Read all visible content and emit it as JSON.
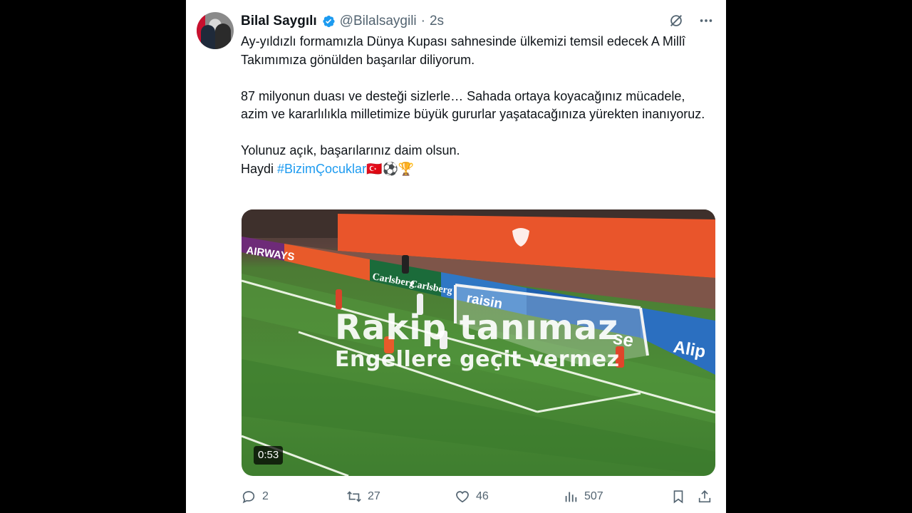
{
  "tweet": {
    "author_name": "Bilal Saygılı",
    "author_handle": "@Bilalsaygili",
    "separator": "·",
    "time": "2s",
    "paragraph_1": "Ay-yıldızlı formamızla Dünya Kupası sahnesinde ülkemizi temsil edecek A Millî Takımımıza gönülden başarılar diliyorum.",
    "paragraph_2": "87 milyonun duası ve desteği sizlerle… Sahada ortaya koyacağınız mücadele, azim ve kararlılıkla milletimize büyük gururlar yaşatacağınıza yürekten inanıyoruz.",
    "paragraph_3": "Yolunuz açık, başarılarınız daim olsun.",
    "haydi": "Haydi ",
    "hashtag": "#BizimÇocuklar",
    "emojis": "🇹🇷⚽🏆"
  },
  "media": {
    "overlay_line_1": "Rakip tanımaz",
    "overlay_line_2": "Engellere geçit vermez",
    "duration": "0:53",
    "ad_boards": [
      "AIRWAYS",
      "Carlsberg",
      "Carlsberg",
      "raisin",
      "se",
      "Alip"
    ]
  },
  "actions": {
    "replies": "2",
    "retweets": "27",
    "likes": "46",
    "views": "507"
  },
  "colors": {
    "accent": "#1d9bf0",
    "text": "#0f1419",
    "muted": "#536471",
    "pitch": "#4b8b36",
    "board_orange": "#e9552b"
  }
}
